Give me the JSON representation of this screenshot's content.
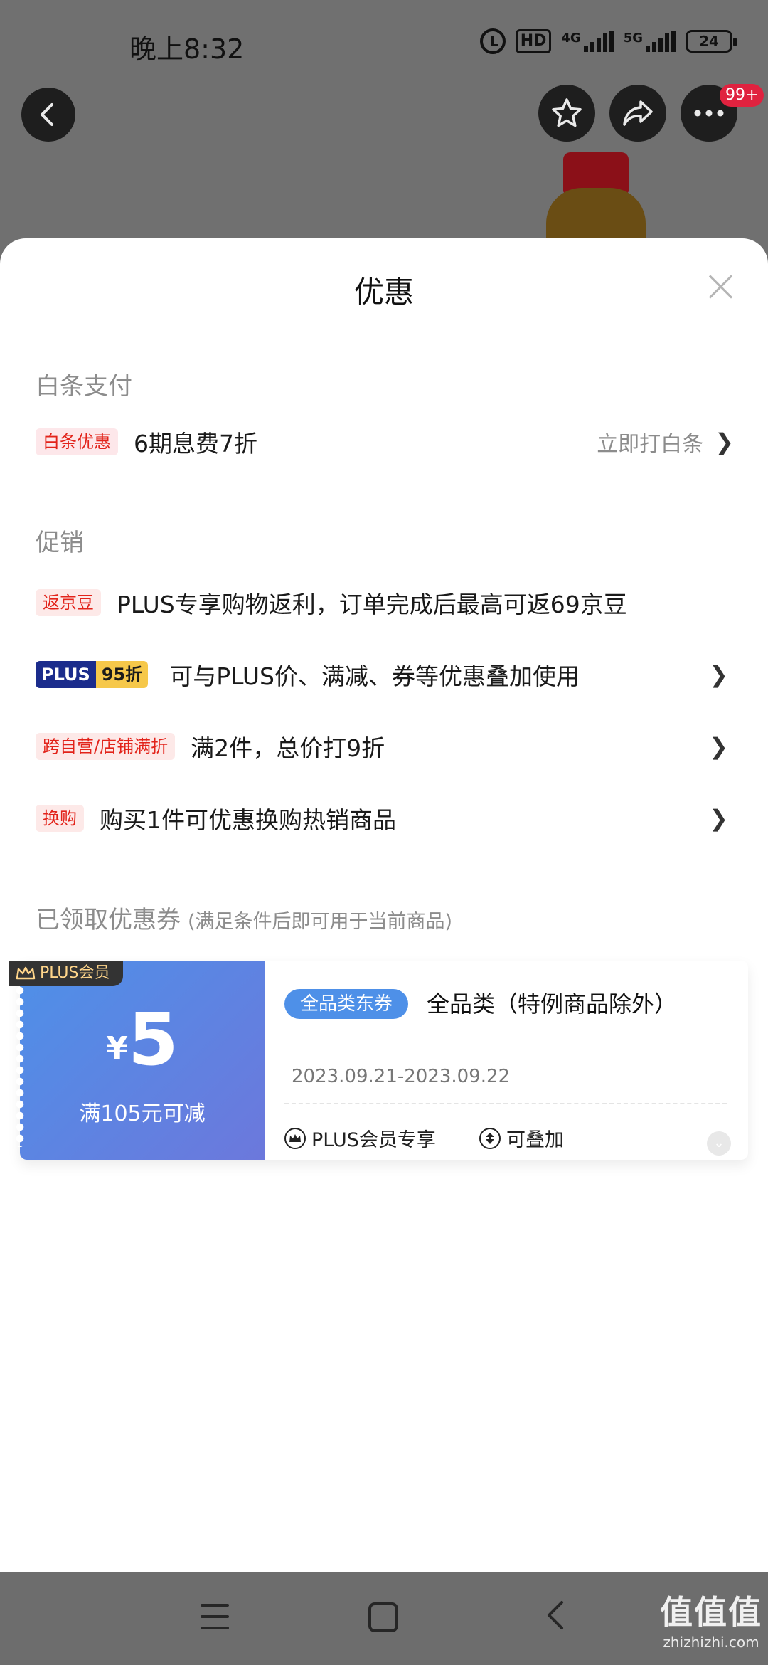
{
  "status_bar": {
    "time": "晚上8:32",
    "hd_label": "HD",
    "net1_label": "4G",
    "net2_label": "5G",
    "battery": "24"
  },
  "top_bar": {
    "badge": "99+"
  },
  "sheet": {
    "title": "优惠",
    "baitiao": {
      "section_label": "白条支付",
      "tag": "白条优惠",
      "text": "6期息费7折",
      "action": "立即打白条"
    },
    "promo": {
      "section_label": "促销",
      "items": [
        {
          "tag": "返京豆",
          "text": "PLUS专享购物返利，订单完成后最高可返69京豆"
        },
        {
          "tag_plus": "PLUS",
          "tag_discount": "95折",
          "text": "可与PLUS价、满减、券等优惠叠加使用"
        },
        {
          "tag": "跨自营/店铺满折",
          "text": "满2件，总价打9折"
        },
        {
          "tag": "换购",
          "text": "购买1件可优惠换购热销商品"
        }
      ]
    },
    "coupons": {
      "section_label": "已领取优惠券",
      "section_note": "(满足条件后即可用于当前商品)",
      "items": [
        {
          "member_label": "PLUS会员",
          "currency": "¥",
          "amount": "5",
          "condition": "满105元可减",
          "category_tag": "全品类东券",
          "category_text": "全品类（特例商品除外）",
          "date_range": "2023.09.21-2023.09.22",
          "perk1": "PLUS会员专享",
          "perk2": "可叠加"
        }
      ]
    }
  },
  "chevron": "❯",
  "watermark": {
    "logo": "值值值",
    "url": "zhizhizhi.com"
  },
  "colors": {
    "accent_red": "#e2231a",
    "plus_navy": "#1b2c8c",
    "plus_gold": "#f6c84a",
    "coupon_blue": "#4e90e8"
  }
}
